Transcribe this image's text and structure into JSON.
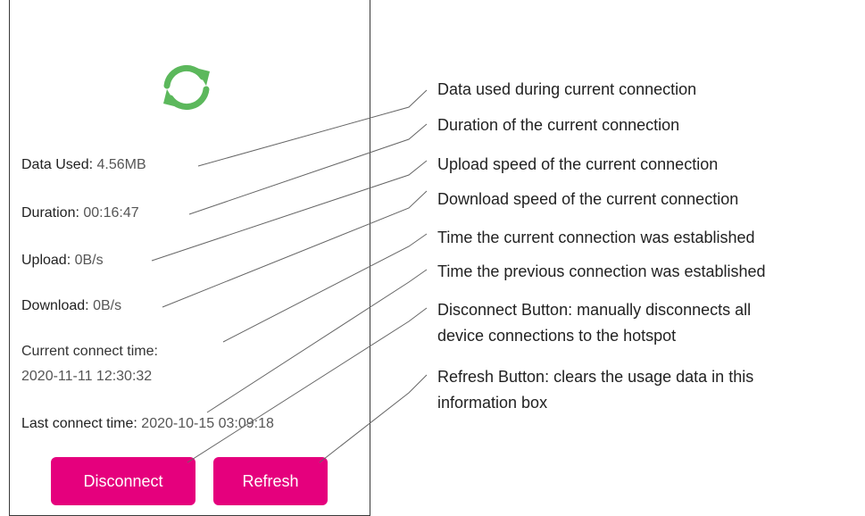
{
  "panel": {
    "fields": [
      {
        "label": "Data Used:",
        "value": "4.56MB"
      },
      {
        "label": "Duration:",
        "value": "00:16:47"
      },
      {
        "label": "Upload:",
        "value": "0B/s"
      },
      {
        "label": "Download:",
        "value": "0B/s"
      },
      {
        "label": "Current connect time:",
        "value": "2020-11-11 12:30:32"
      },
      {
        "label": "Last connect time:",
        "value": "2020-10-15 03:09:18"
      }
    ],
    "disconnect_label": "Disconnect",
    "refresh_label": "Refresh",
    "accent_color": "#e5007d",
    "icon_color": "#5cb85c"
  },
  "annotations": [
    "Data used during current connection",
    "Duration of the current connection",
    "Upload speed of the current connection",
    "Download speed of the current connection",
    "Time the current connection was established",
    "Time the previous connection was established",
    "Disconnect Button: manually disconnects all",
    "device connections to the hotspot",
    "Refresh Button: clears the usage data in this",
    "information box"
  ]
}
